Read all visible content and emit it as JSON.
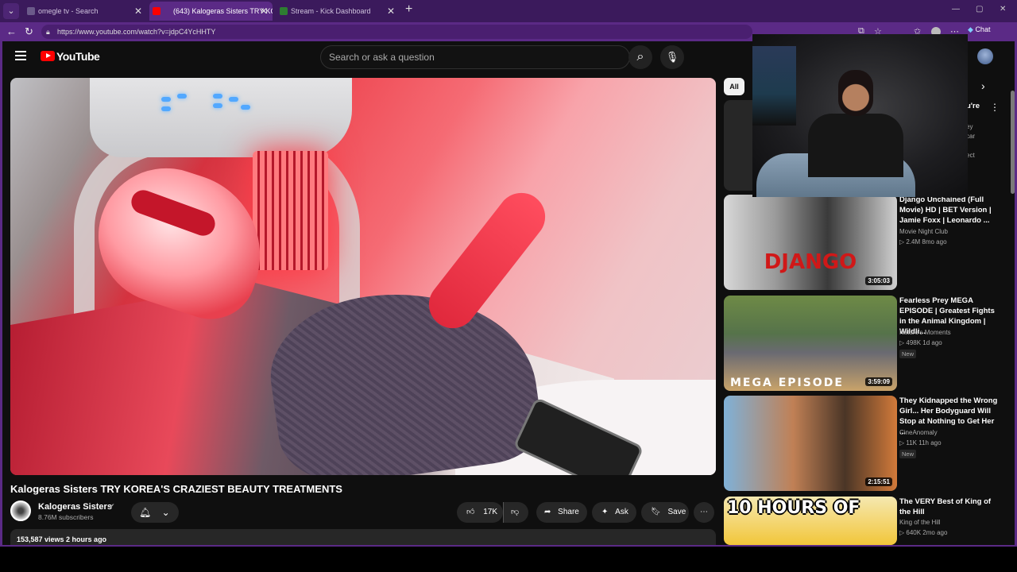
{
  "browser": {
    "tabs": [
      {
        "title": "omegle tv - Search",
        "active": false
      },
      {
        "title": "(643) Kalogeras Sisters TRY KO",
        "active": true
      },
      {
        "title": "Stream - Kick Dashboard",
        "active": false
      }
    ],
    "url": "https://www.youtube.com/watch?v=jdpC4YcHHTY",
    "chat_label": "Chat",
    "accent": "#5b2a86"
  },
  "youtube": {
    "logo_text": "YouTube",
    "search_placeholder": "Search or ask a question",
    "video": {
      "title": "Kalogeras Sisters TRY KOREA'S CRAZIEST BEAUTY TREATMENTS",
      "channel": "Kalogeras Sisters",
      "subscribers": "8.76M subscribers",
      "likes": "17K",
      "share_label": "Share",
      "ask_label": "Ask",
      "save_label": "Save",
      "views_line": "153,587 views  2 hours ago"
    },
    "filter_chip": "All",
    "ghost_fragments": [
      "u're",
      "ey",
      "car",
      "ect"
    ],
    "recommendations": [
      {
        "title": "Django Unchained (Full Movie) HD | BET Version | Jamie Foxx | Leonardo ...",
        "channel": "Movie Night Club",
        "meta": "▷ 2.4M  8mo ago",
        "duration": "3:05:03",
        "badge": "",
        "thumb_text": "DJANGO"
      },
      {
        "title": "Fearless Prey MEGA EPISODE | Greatest Fights in the Animal Kingdom | Wildli...",
        "channel": "Nature's Moments",
        "meta": "▷ 498K  1d ago",
        "duration": "3:59:09",
        "badge": "New",
        "thumb_text": "MEGA EPISODE"
      },
      {
        "title": "They Kidnapped the Wrong Girl... Her Bodyguard Will Stop at Nothing to Get Her ...",
        "channel": "CineAnomaly",
        "meta": "▷ 11K  11h ago",
        "duration": "2:15:51",
        "badge": "New",
        "thumb_text": ""
      },
      {
        "title": "The VERY Best of King of the Hill",
        "channel": "King of the Hill",
        "meta": "▷ 640K  2mo ago",
        "duration": "",
        "badge": "",
        "thumb_text": "10 HOURS OF"
      }
    ]
  }
}
